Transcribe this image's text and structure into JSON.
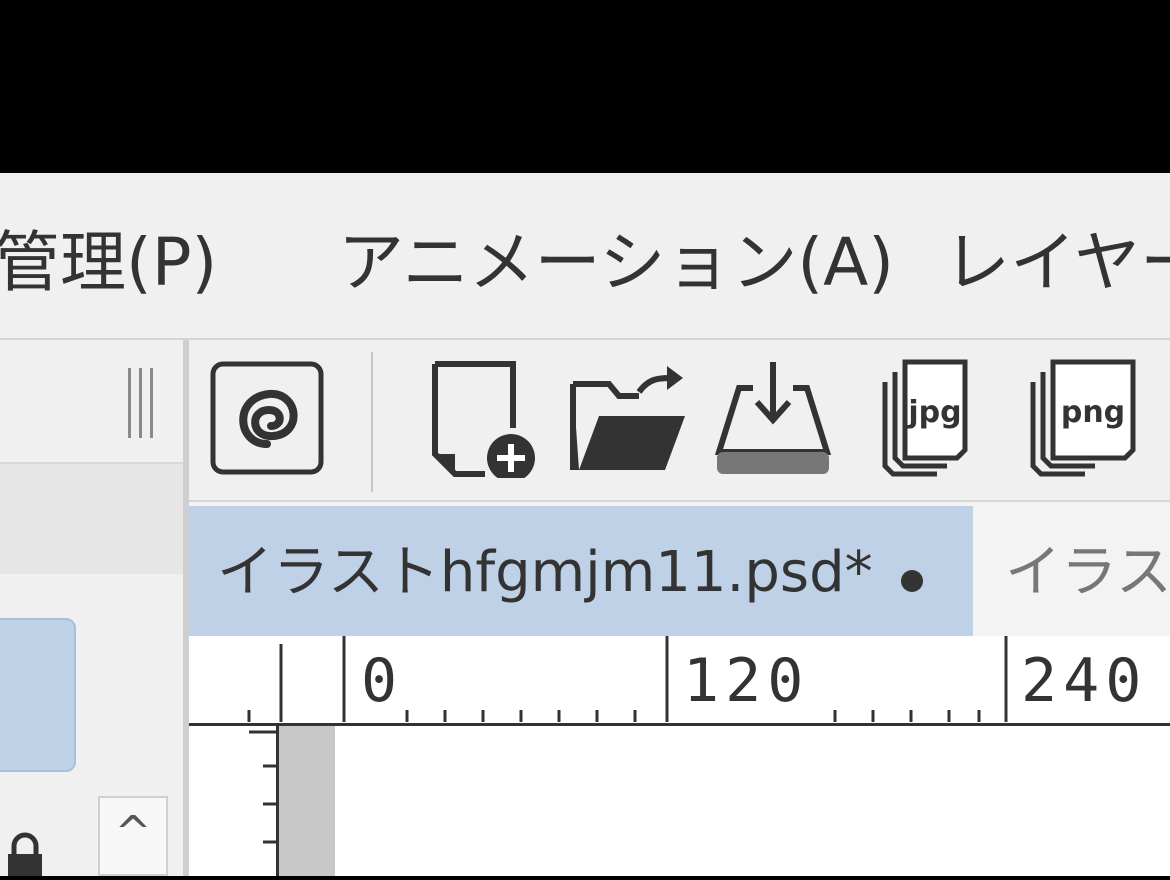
{
  "menubar": {
    "items": [
      {
        "label": "管理(P)"
      },
      {
        "label": "アニメーション(A)"
      },
      {
        "label": "レイヤー"
      }
    ]
  },
  "left_panel": {
    "scroll_up_glyph": "^"
  },
  "toolbar": {
    "buttons": [
      {
        "icon": "swirl-logo-icon"
      },
      {
        "icon": "new-file-icon"
      },
      {
        "icon": "open-folder-icon"
      },
      {
        "icon": "save-download-icon"
      },
      {
        "icon": "export-jpg-icon",
        "text": "jpg"
      },
      {
        "icon": "export-png-icon",
        "text": "png"
      }
    ]
  },
  "tabs": {
    "active": {
      "label": "イラストhfgmjm11.psd*"
    },
    "inactive": {
      "label": "イラスト"
    }
  },
  "ruler": {
    "labels": [
      "0",
      "120",
      "240"
    ]
  },
  "colors": {
    "menubar_bg": "#f0f0f0",
    "active_tab": "#bfd1e6",
    "titlebar": "#000000"
  }
}
